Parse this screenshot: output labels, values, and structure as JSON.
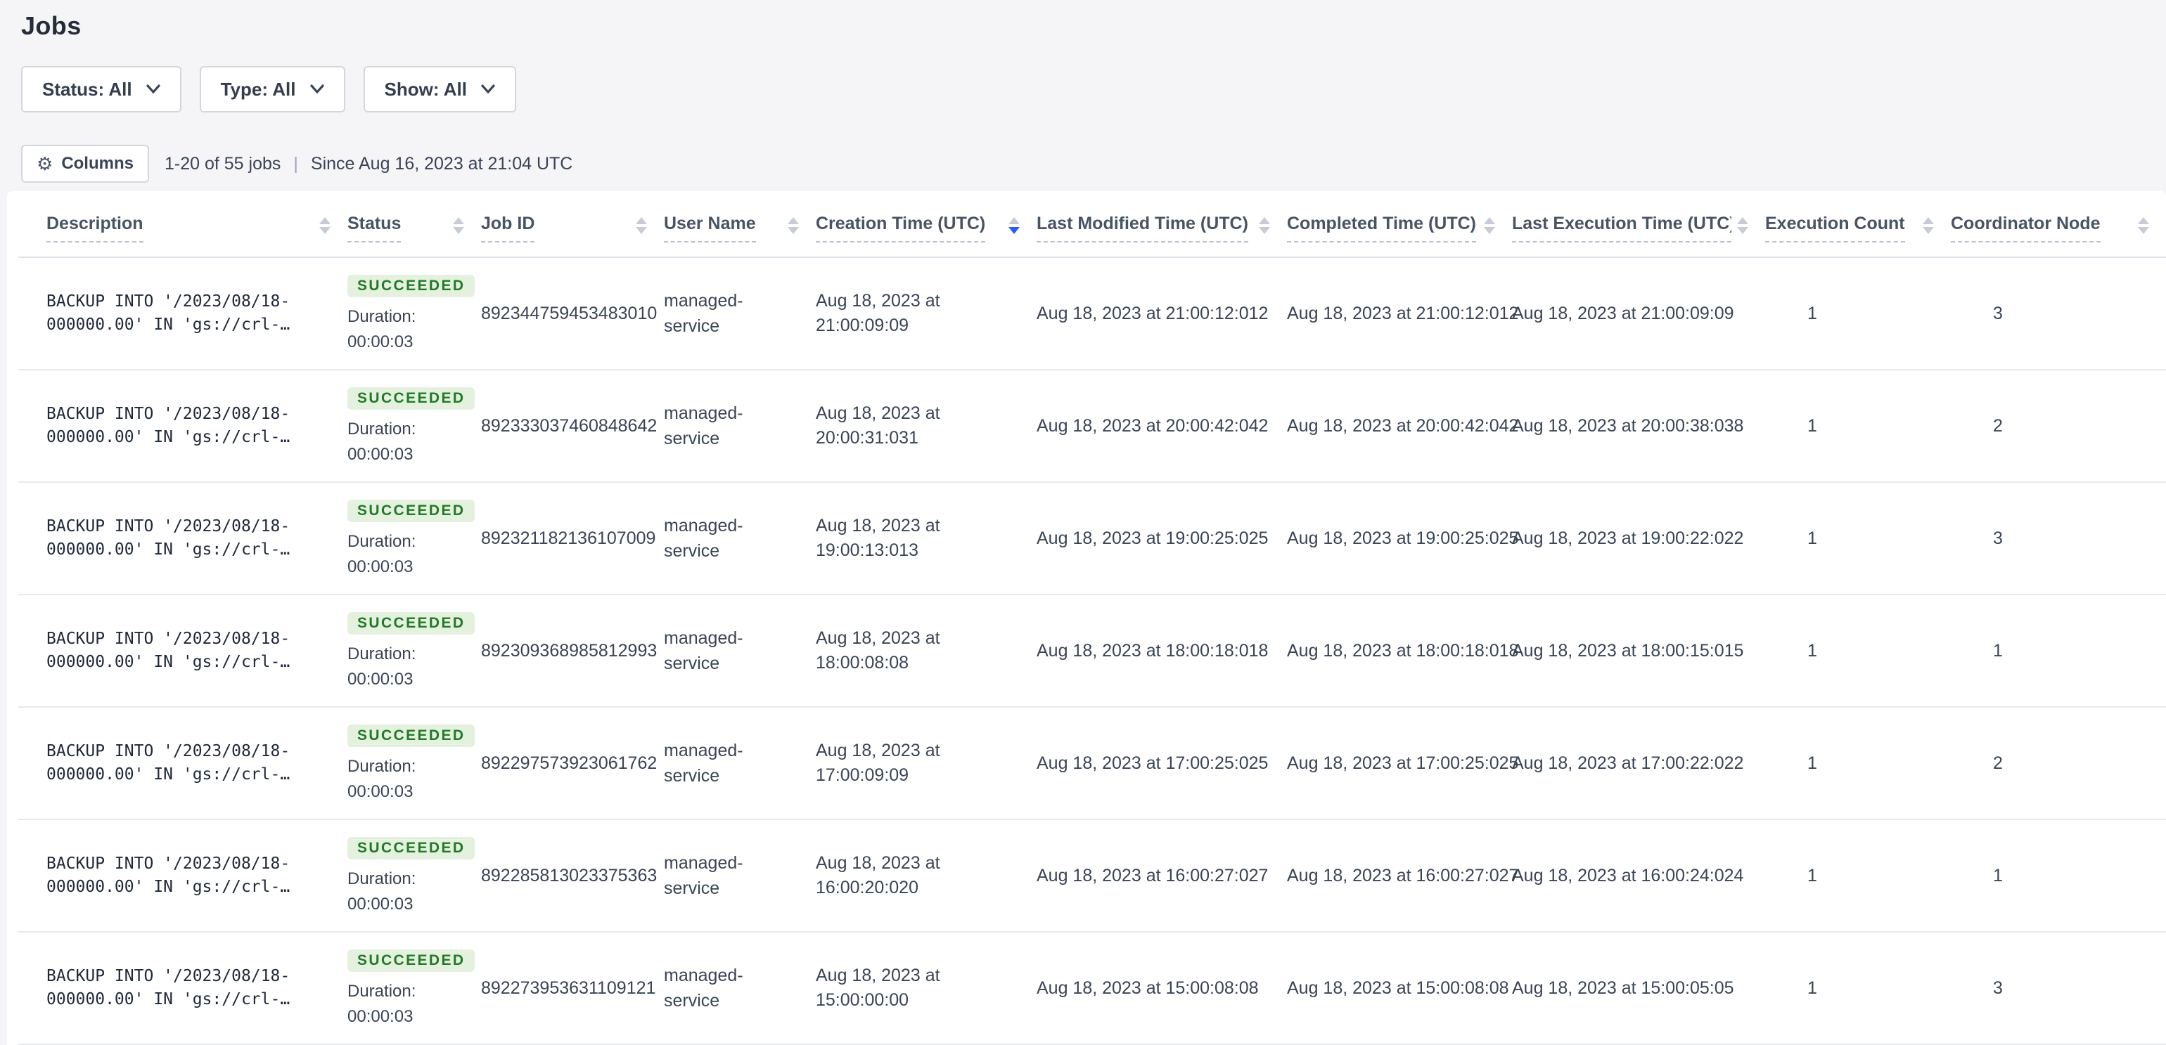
{
  "page": {
    "title": "Jobs"
  },
  "filters": {
    "status": "Status: All",
    "type": "Type: All",
    "show": "Show: All"
  },
  "toolbar": {
    "gear_icon": "⚙",
    "columns_label": "Columns",
    "count_text": "1-20 of 55 jobs",
    "separator": "|",
    "since_text": "Since Aug 16, 2023 at 21:04 UTC"
  },
  "colors": {
    "page_background": "#f5f5f8",
    "badge_background": "#e4f1df",
    "badge_text": "#237a26",
    "sort_active_blue": "#2c5bf2"
  },
  "table": {
    "duration_label": "Duration:",
    "columns": [
      {
        "label": "Description",
        "sort": "none"
      },
      {
        "label": "Status",
        "sort": "none"
      },
      {
        "label": "Job ID",
        "sort": "none"
      },
      {
        "label": "User Name",
        "sort": "none"
      },
      {
        "label": "Creation Time (UTC)",
        "sort": "desc"
      },
      {
        "label": "Last Modified Time (UTC)",
        "sort": "none"
      },
      {
        "label": "Completed Time (UTC)",
        "sort": "none"
      },
      {
        "label": "Last Execution Time (UTC)",
        "sort": "none"
      },
      {
        "label": "Execution Count",
        "sort": "none"
      },
      {
        "label": "Coordinator Node",
        "sort": "none"
      }
    ],
    "rows": [
      {
        "description": "BACKUP INTO '/2023/08/18-000000.00' IN 'gs://crl-…",
        "status": "SUCCEEDED",
        "duration": "00:00:03",
        "job_id": "892344759453483010",
        "user_name": "managed-service",
        "creation_time": "Aug 18, 2023 at 21:00:09:09",
        "last_modified_time": "Aug 18, 2023 at 21:00:12:012",
        "completed_time": "Aug 18, 2023 at 21:00:12:012",
        "last_execution_time": "Aug 18, 2023 at 21:00:09:09",
        "execution_count": "1",
        "coordinator_node": "3"
      },
      {
        "description": "BACKUP INTO '/2023/08/18-000000.00' IN 'gs://crl-…",
        "status": "SUCCEEDED",
        "duration": "00:00:03",
        "job_id": "892333037460848642",
        "user_name": "managed-service",
        "creation_time": "Aug 18, 2023 at 20:00:31:031",
        "last_modified_time": "Aug 18, 2023 at 20:00:42:042",
        "completed_time": "Aug 18, 2023 at 20:00:42:042",
        "last_execution_time": "Aug 18, 2023 at 20:00:38:038",
        "execution_count": "1",
        "coordinator_node": "2"
      },
      {
        "description": "BACKUP INTO '/2023/08/18-000000.00' IN 'gs://crl-…",
        "status": "SUCCEEDED",
        "duration": "00:00:03",
        "job_id": "892321182136107009",
        "user_name": "managed-service",
        "creation_time": "Aug 18, 2023 at 19:00:13:013",
        "last_modified_time": "Aug 18, 2023 at 19:00:25:025",
        "completed_time": "Aug 18, 2023 at 19:00:25:025",
        "last_execution_time": "Aug 18, 2023 at 19:00:22:022",
        "execution_count": "1",
        "coordinator_node": "3"
      },
      {
        "description": "BACKUP INTO '/2023/08/18-000000.00' IN 'gs://crl-…",
        "status": "SUCCEEDED",
        "duration": "00:00:03",
        "job_id": "892309368985812993",
        "user_name": "managed-service",
        "creation_time": "Aug 18, 2023 at 18:00:08:08",
        "last_modified_time": "Aug 18, 2023 at 18:00:18:018",
        "completed_time": "Aug 18, 2023 at 18:00:18:018",
        "last_execution_time": "Aug 18, 2023 at 18:00:15:015",
        "execution_count": "1",
        "coordinator_node": "1"
      },
      {
        "description": "BACKUP INTO '/2023/08/18-000000.00' IN 'gs://crl-…",
        "status": "SUCCEEDED",
        "duration": "00:00:03",
        "job_id": "892297573923061762",
        "user_name": "managed-service",
        "creation_time": "Aug 18, 2023 at 17:00:09:09",
        "last_modified_time": "Aug 18, 2023 at 17:00:25:025",
        "completed_time": "Aug 18, 2023 at 17:00:25:025",
        "last_execution_time": "Aug 18, 2023 at 17:00:22:022",
        "execution_count": "1",
        "coordinator_node": "2"
      },
      {
        "description": "BACKUP INTO '/2023/08/18-000000.00' IN 'gs://crl-…",
        "status": "SUCCEEDED",
        "duration": "00:00:03",
        "job_id": "892285813023375363",
        "user_name": "managed-service",
        "creation_time": "Aug 18, 2023 at 16:00:20:020",
        "last_modified_time": "Aug 18, 2023 at 16:00:27:027",
        "completed_time": "Aug 18, 2023 at 16:00:27:027",
        "last_execution_time": "Aug 18, 2023 at 16:00:24:024",
        "execution_count": "1",
        "coordinator_node": "1"
      },
      {
        "description": "BACKUP INTO '/2023/08/18-000000.00' IN 'gs://crl-…",
        "status": "SUCCEEDED",
        "duration": "00:00:03",
        "job_id": "892273953631109121",
        "user_name": "managed-service",
        "creation_time": "Aug 18, 2023 at 15:00:00:00",
        "last_modified_time": "Aug 18, 2023 at 15:00:08:08",
        "completed_time": "Aug 18, 2023 at 15:00:08:08",
        "last_execution_time": "Aug 18, 2023 at 15:00:05:05",
        "execution_count": "1",
        "coordinator_node": "3"
      }
    ]
  }
}
